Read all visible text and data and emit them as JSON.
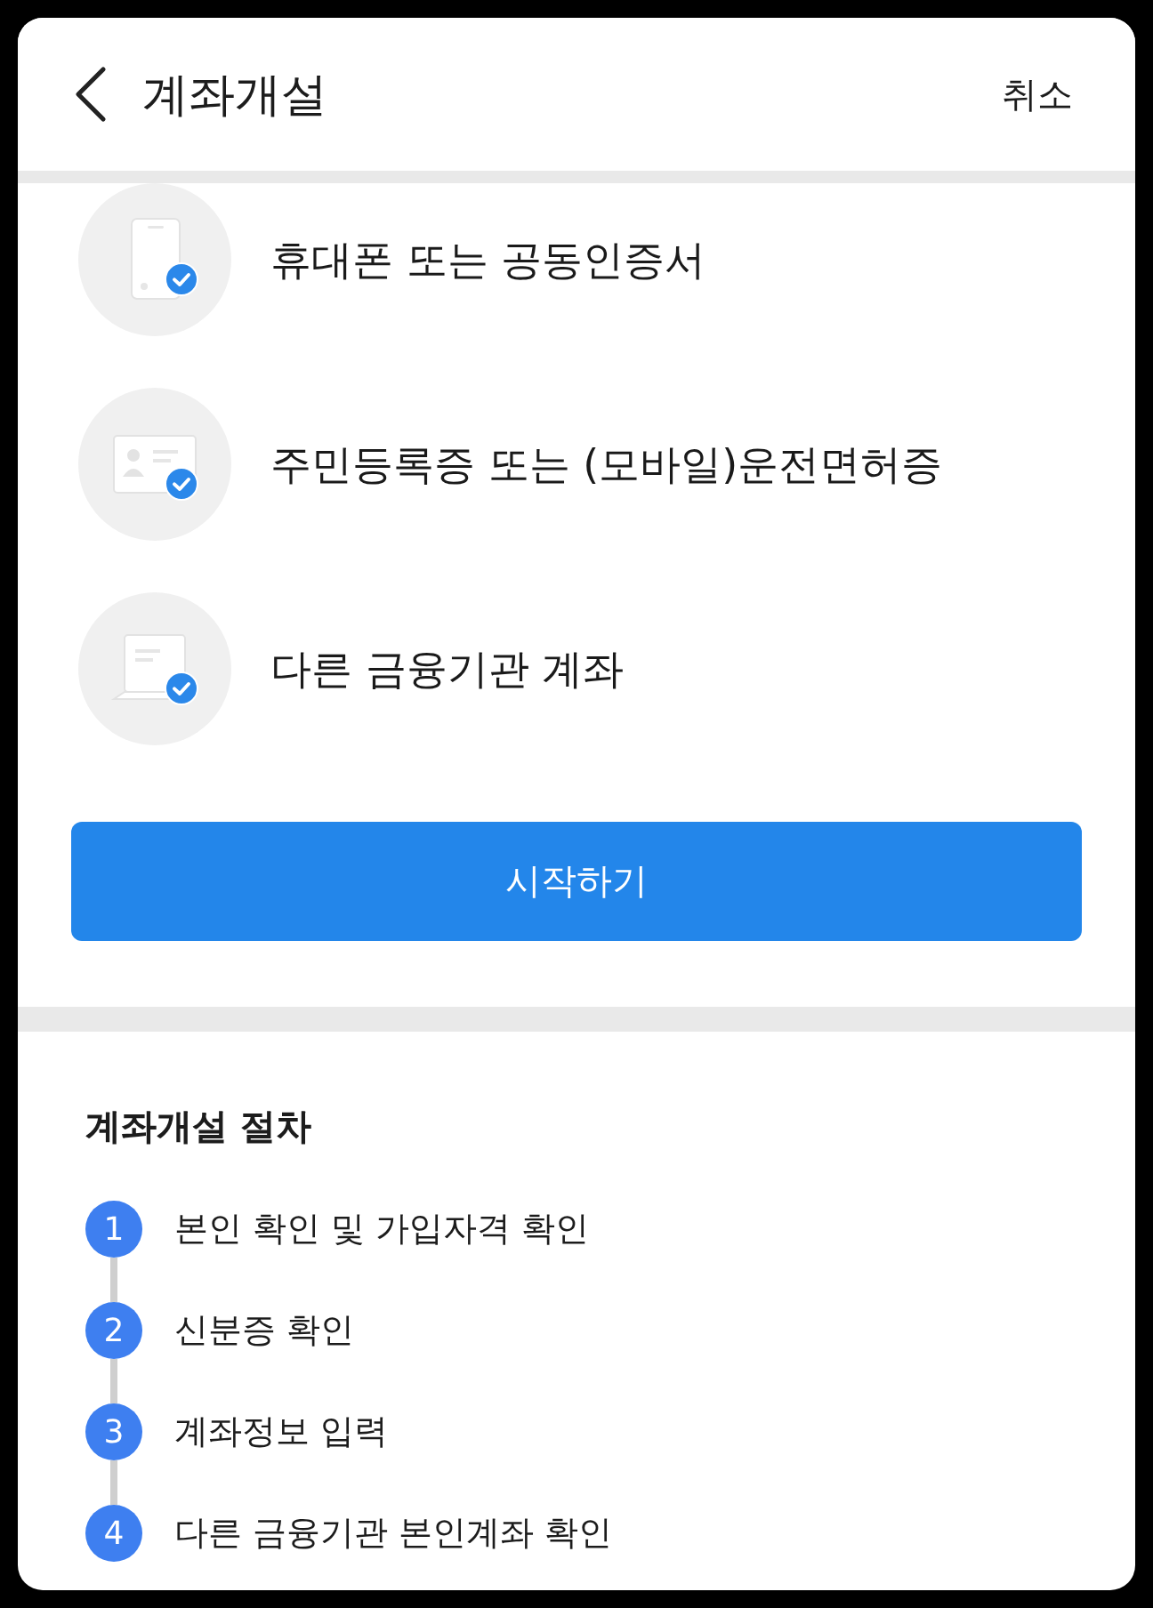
{
  "header": {
    "title": "계좌개설",
    "cancel": "취소"
  },
  "requirements": [
    {
      "kind": "phone",
      "label": "휴대폰 또는 공동인증서"
    },
    {
      "kind": "id-card",
      "label": "주민등록증 또는 (모바일)운전면허증"
    },
    {
      "kind": "document",
      "label": "다른 금융기관 계좌"
    }
  ],
  "start_button": "시작하기",
  "procedure": {
    "title": "계좌개설 절차",
    "steps": [
      {
        "number": "1",
        "label": "본인 확인 및 가입자격 확인"
      },
      {
        "number": "2",
        "label": "신분증 확인"
      },
      {
        "number": "3",
        "label": "계좌정보 입력"
      },
      {
        "number": "4",
        "label": "다른 금융기관 본인계좌 확인"
      }
    ]
  }
}
